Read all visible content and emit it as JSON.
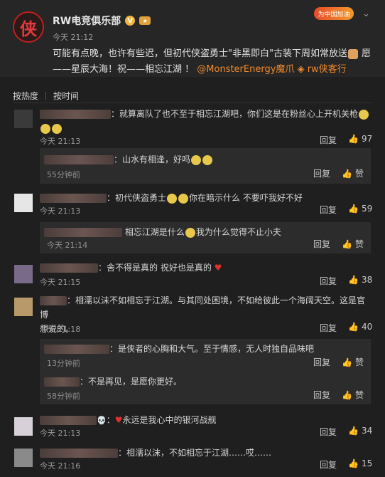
{
  "post": {
    "author": "RW电竞俱乐部",
    "avatar_char": "侠",
    "time": "今天 21:12",
    "badge_text": "为中国加油",
    "text_line1": "可能有点晚，也许有些迟，但初代侠盗勇士\"非黑即白\"古装下周如常放送",
    "text_line1_tail": "愿",
    "text_line2_a": "——星辰大海！祝——相忘江湖 ！",
    "mention1": "@MonsterEnergy魔爪",
    "mention2": "rw侠客行"
  },
  "sort": {
    "hot": "按热度",
    "time": "按时间"
  },
  "labels": {
    "reply": "回复",
    "like": "赞"
  },
  "comments": [
    {
      "text": "：就算离队了也不至于相忘江湖吧，你们这是在粉丝心上开机关枪",
      "time": "今天 21:13",
      "likes": "97"
    },
    {
      "text": "：山水有相逢，好吗",
      "time": "55分钟前"
    },
    {
      "text": "：初代侠盗勇士",
      "text2": "你在暗示什么 不要吓我好不好",
      "time": "今天 21:13",
      "likes": "59"
    },
    {
      "text": "相忘江湖是什么",
      "text2": "我为什么觉得不止小夫",
      "time": "今天 21:14"
    },
    {
      "text": "：舍不得是真的  祝好也是真的",
      "time": "今天 21:15",
      "likes": "38"
    },
    {
      "text": "：相濡以沫不如相忘于江湖。与其同处困境，不如给彼此一个海阔天空。这是官博",
      "text_line2": "想说的。",
      "time": "今天 21:18",
      "likes": "40"
    },
    {
      "text": "：是侠者的心胸和大气。至于情感，无人时独自品味吧",
      "time": "13分钟前"
    },
    {
      "text": "：不是再见，是愿你更好。",
      "time": "58分钟前"
    },
    {
      "text": "永远是我心中的银河战舰",
      "time": "今天 21:13",
      "likes": "34"
    },
    {
      "text": "：相濡以沫，不如相忘于江湖……哎……",
      "time": "今天 21:16",
      "likes": "15"
    }
  ]
}
